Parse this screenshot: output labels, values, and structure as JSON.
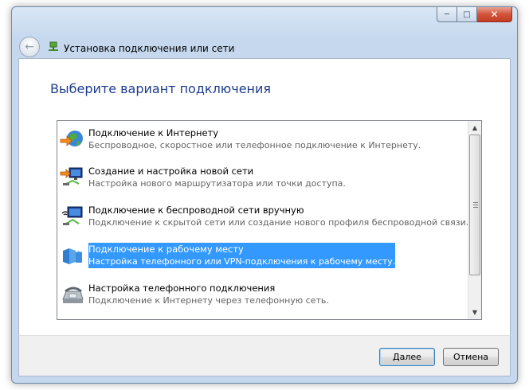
{
  "window": {
    "controls": {
      "minimize": "─",
      "maximize": "□",
      "close": "✕"
    }
  },
  "nav": {
    "back_icon": "back-arrow-icon",
    "title": "Установка подключения или сети"
  },
  "heading": "Выберите вариант подключения",
  "options": [
    {
      "title": "Подключение к Интернету",
      "desc": "Беспроводное, скоростное или телефонное подключение к Интернету.",
      "icon": "globe-icon"
    },
    {
      "title": "Создание и настройка новой сети",
      "desc": "Настройка нового маршрутизатора или точки доступа.",
      "icon": "new-network-icon"
    },
    {
      "title": "Подключение к беспроводной сети вручную",
      "desc": "Подключение к скрытой сети или создание нового профиля беспроводной связи.",
      "icon": "wireless-network-icon"
    },
    {
      "title": "Подключение к рабочему месту",
      "desc": "Настройка телефонного или VPN-подключения к рабочему месту.",
      "icon": "workplace-icon",
      "selected": true
    },
    {
      "title": "Настройка телефонного подключения",
      "desc": "Подключение к Интернету через телефонную сеть.",
      "icon": "phone-icon"
    }
  ],
  "buttons": {
    "next": "Далее",
    "cancel": "Отмена"
  },
  "colors": {
    "heading": "#1e3d8f",
    "selection": "#3399ff"
  }
}
